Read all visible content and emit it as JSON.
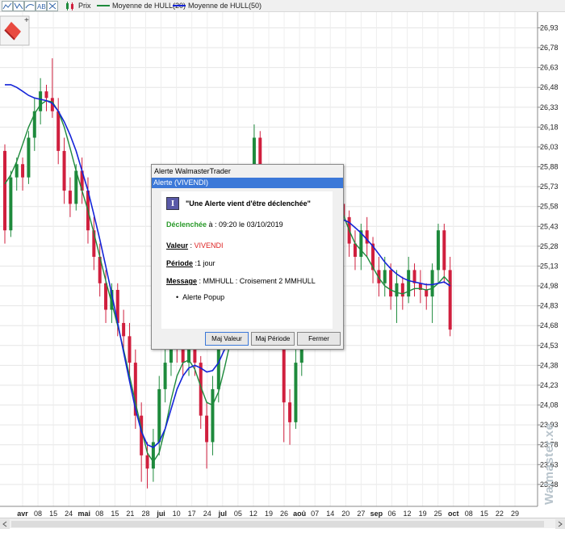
{
  "legend": {
    "items": [
      {
        "label": "Prix",
        "color": "#cc1f3f"
      },
      {
        "label": "Moyenne de HULL(20)",
        "color": "#1e8a3c"
      },
      {
        "label": "Moyenne de HULL(50)",
        "color": "#1424d8"
      }
    ],
    "toolbar_icons": [
      "line-tool-icon",
      "zoom-tool-icon",
      "draw-tool-icon",
      "text-tool-icon",
      "cross-tool-icon"
    ]
  },
  "chart_data": {
    "type": "candlestick",
    "y_ticks": [
      "26,93",
      "26,78",
      "26,63",
      "26,48",
      "26,33",
      "26,18",
      "26,03",
      "25,88",
      "25,73",
      "25,58",
      "25,43",
      "25,28",
      "25,13",
      "24,98",
      "24,83",
      "24,68",
      "24,53",
      "24,38",
      "24,23",
      "24,08",
      "23,93",
      "23,78",
      "23,63",
      "23,48"
    ],
    "ylim": [
      23.4,
      27.0
    ],
    "x_labels": [
      {
        "text": "avr",
        "month": true
      },
      {
        "text": "08"
      },
      {
        "text": "15"
      },
      {
        "text": "24"
      },
      {
        "text": "mai",
        "month": true
      },
      {
        "text": "08"
      },
      {
        "text": "15"
      },
      {
        "text": "21"
      },
      {
        "text": "28"
      },
      {
        "text": "jui",
        "month": true
      },
      {
        "text": "10"
      },
      {
        "text": "17"
      },
      {
        "text": "24"
      },
      {
        "text": "jul",
        "month": true
      },
      {
        "text": "05"
      },
      {
        "text": "12"
      },
      {
        "text": "19"
      },
      {
        "text": "26"
      },
      {
        "text": "aoû",
        "month": true
      },
      {
        "text": "07"
      },
      {
        "text": "14"
      },
      {
        "text": "20"
      },
      {
        "text": "27"
      },
      {
        "text": "sep",
        "month": true
      },
      {
        "text": "06"
      },
      {
        "text": "12"
      },
      {
        "text": "19"
      },
      {
        "text": "25"
      },
      {
        "text": "oct",
        "month": true
      },
      {
        "text": "08"
      },
      {
        "text": "15"
      },
      {
        "text": "22"
      },
      {
        "text": "29"
      }
    ],
    "candles": [
      [
        26.0,
        25.4,
        26.05,
        25.3
      ],
      [
        25.4,
        25.8,
        25.85,
        25.35
      ],
      [
        25.8,
        25.9,
        25.95,
        25.7
      ],
      [
        25.9,
        25.8,
        25.95,
        25.7
      ],
      [
        25.8,
        26.1,
        26.15,
        25.75
      ],
      [
        26.1,
        26.3,
        26.4,
        26.0
      ],
      [
        26.3,
        26.45,
        26.55,
        26.2
      ],
      [
        26.45,
        26.4,
        26.5,
        26.3
      ],
      [
        26.4,
        26.3,
        26.7,
        26.25
      ],
      [
        26.3,
        26.0,
        26.4,
        25.9
      ],
      [
        26.0,
        25.7,
        26.1,
        25.6
      ],
      [
        25.7,
        25.6,
        25.8,
        25.5
      ],
      [
        25.6,
        25.85,
        25.9,
        25.55
      ],
      [
        25.85,
        25.7,
        25.95,
        25.6
      ],
      [
        25.7,
        25.4,
        25.8,
        25.3
      ],
      [
        25.4,
        25.2,
        25.5,
        25.1
      ],
      [
        25.2,
        25.0,
        25.3,
        24.9
      ],
      [
        25.0,
        24.8,
        25.1,
        24.7
      ],
      [
        24.8,
        24.95,
        25.0,
        24.7
      ],
      [
        24.95,
        24.7,
        25.0,
        24.6
      ],
      [
        24.7,
        24.6,
        24.8,
        24.5
      ],
      [
        24.6,
        24.4,
        24.7,
        24.3
      ],
      [
        24.4,
        24.0,
        24.5,
        23.9
      ],
      [
        24.0,
        23.7,
        24.1,
        23.5
      ],
      [
        23.7,
        23.6,
        23.8,
        23.45
      ],
      [
        23.6,
        23.8,
        23.9,
        23.5
      ],
      [
        23.8,
        24.2,
        24.3,
        23.7
      ],
      [
        24.2,
        24.4,
        24.5,
        24.1
      ],
      [
        24.4,
        24.6,
        24.7,
        24.3
      ],
      [
        24.6,
        24.5,
        24.75,
        24.4
      ],
      [
        24.5,
        24.4,
        24.6,
        24.3
      ],
      [
        24.4,
        24.6,
        24.7,
        24.3
      ],
      [
        24.6,
        24.4,
        24.65,
        24.3
      ],
      [
        24.4,
        24.0,
        24.45,
        23.9
      ],
      [
        24.0,
        23.8,
        24.1,
        23.6
      ],
      [
        23.8,
        24.2,
        24.3,
        23.7
      ],
      [
        24.2,
        24.6,
        24.7,
        24.1
      ],
      [
        24.6,
        24.8,
        24.9,
        24.5
      ],
      [
        24.8,
        24.7,
        24.95,
        24.6
      ],
      [
        24.7,
        25.0,
        25.1,
        24.6
      ],
      [
        25.0,
        25.4,
        25.5,
        24.9
      ],
      [
        25.4,
        25.8,
        25.9,
        25.3
      ],
      [
        25.8,
        26.1,
        26.2,
        25.7
      ],
      [
        26.1,
        25.8,
        26.15,
        25.7
      ],
      [
        25.8,
        25.6,
        25.9,
        25.5
      ],
      [
        25.6,
        25.2,
        25.7,
        25.1
      ],
      [
        25.2,
        24.6,
        25.3,
        24.5
      ],
      [
        24.6,
        24.1,
        24.7,
        23.8
      ],
      [
        24.1,
        23.95,
        24.2,
        23.78
      ],
      [
        23.95,
        24.4,
        24.5,
        23.9
      ],
      [
        24.4,
        24.8,
        24.9,
        24.3
      ],
      [
        24.8,
        25.2,
        25.3,
        24.7
      ],
      [
        25.2,
        25.5,
        25.6,
        25.1
      ],
      [
        25.5,
        25.7,
        25.8,
        25.4
      ],
      [
        25.7,
        25.6,
        25.88,
        25.5
      ],
      [
        25.6,
        25.4,
        25.7,
        25.3
      ],
      [
        25.4,
        25.6,
        25.65,
        25.3
      ],
      [
        25.6,
        25.5,
        25.7,
        25.4
      ],
      [
        25.5,
        25.3,
        25.55,
        25.2
      ],
      [
        25.3,
        25.2,
        25.4,
        25.1
      ],
      [
        25.2,
        25.4,
        25.45,
        25.1
      ],
      [
        25.4,
        25.3,
        25.5,
        25.2
      ],
      [
        25.3,
        25.1,
        25.35,
        25.0
      ],
      [
        25.1,
        25.0,
        25.2,
        24.9
      ],
      [
        25.0,
        25.1,
        25.2,
        24.9
      ],
      [
        25.1,
        24.9,
        25.15,
        24.8
      ],
      [
        24.9,
        25.0,
        25.1,
        24.7
      ],
      [
        25.0,
        24.9,
        25.05,
        24.8
      ],
      [
        24.9,
        25.1,
        25.2,
        24.85
      ],
      [
        25.1,
        25.0,
        25.15,
        24.9
      ],
      [
        25.0,
        24.95,
        25.1,
        24.85
      ],
      [
        24.95,
        24.9,
        25.0,
        24.8
      ],
      [
        24.9,
        25.1,
        25.15,
        24.7
      ],
      [
        25.1,
        25.4,
        25.45,
        25.0
      ],
      [
        25.4,
        25.1,
        25.45,
        25.0
      ],
      [
        25.1,
        24.65,
        25.2,
        24.6
      ]
    ],
    "series": [
      {
        "name": "Moyenne de HULL(20)",
        "values": [
          25.75,
          25.82,
          25.92,
          26.05,
          26.18,
          26.28,
          26.35,
          26.38,
          26.37,
          26.3,
          26.18,
          26.02,
          25.85,
          25.7,
          25.55,
          25.38,
          25.2,
          25.02,
          24.85,
          24.68,
          24.5,
          24.3,
          24.1,
          23.9,
          23.72,
          23.65,
          23.72,
          23.9,
          24.12,
          24.3,
          24.4,
          24.42,
          24.35,
          24.22,
          24.1,
          24.08,
          24.18,
          24.36,
          24.56,
          24.78,
          25.02,
          25.28,
          25.52,
          25.68,
          25.72,
          25.62,
          25.42,
          25.1,
          24.8,
          24.68,
          24.75,
          24.95,
          25.22,
          25.48,
          25.65,
          25.7,
          25.62,
          25.52,
          25.4,
          25.3,
          25.25,
          25.2,
          25.12,
          25.04,
          24.98,
          24.95,
          24.93,
          24.92,
          24.94,
          24.96,
          24.96,
          24.95,
          24.96,
          25.0,
          25.05,
          25.0
        ]
      },
      {
        "name": "Moyenne de HULL(50)",
        "values": [
          26.5,
          26.5,
          26.48,
          26.45,
          26.42,
          26.4,
          26.39,
          26.38,
          26.36,
          26.3,
          26.22,
          26.12,
          26.0,
          25.85,
          25.7,
          25.52,
          25.33,
          25.13,
          24.92,
          24.7,
          24.48,
          24.26,
          24.05,
          23.88,
          23.78,
          23.76,
          23.8,
          23.9,
          24.05,
          24.2,
          24.3,
          24.36,
          24.38,
          24.36,
          24.33,
          24.34,
          24.4,
          24.5,
          24.62,
          24.76,
          24.92,
          25.08,
          25.22,
          25.32,
          25.38,
          25.38,
          25.32,
          25.22,
          25.12,
          25.06,
          25.06,
          25.1,
          25.18,
          25.28,
          25.38,
          25.45,
          25.48,
          25.48,
          25.46,
          25.42,
          25.38,
          25.33,
          25.28,
          25.22,
          25.16,
          25.11,
          25.07,
          25.04,
          25.02,
          25.01,
          25.0,
          24.99,
          24.99,
          25.0,
          25.01,
          24.98
        ]
      }
    ],
    "colors": {
      "up": "#1e8a3c",
      "down": "#d01f3e",
      "hull20": "#1e8a3c",
      "hull50": "#1424d8"
    }
  },
  "dialog": {
    "title": "Alerte WalmasterTrader",
    "subtitle": "Alerte (VIVENDI)",
    "headline": "\"Une Alerte vient d'être déclenchée\"",
    "triggered_label": "Déclenchée",
    "triggered_value": " à : 09:20 le 03/10/2019",
    "value_label": "Valeur",
    "value_value": "VIVENDI",
    "period_label": "Période",
    "period_value": " :1 jour",
    "message_label": "Message",
    "message_value": " : MMHULL : Croisement 2 MMHULL",
    "bullet": "Alerte Popup",
    "buttons": {
      "maj_valeur": "Maj Valeur",
      "maj_periode": "Maj Période",
      "fermer": "Fermer"
    }
  },
  "watermark": "Walmaster.xe"
}
